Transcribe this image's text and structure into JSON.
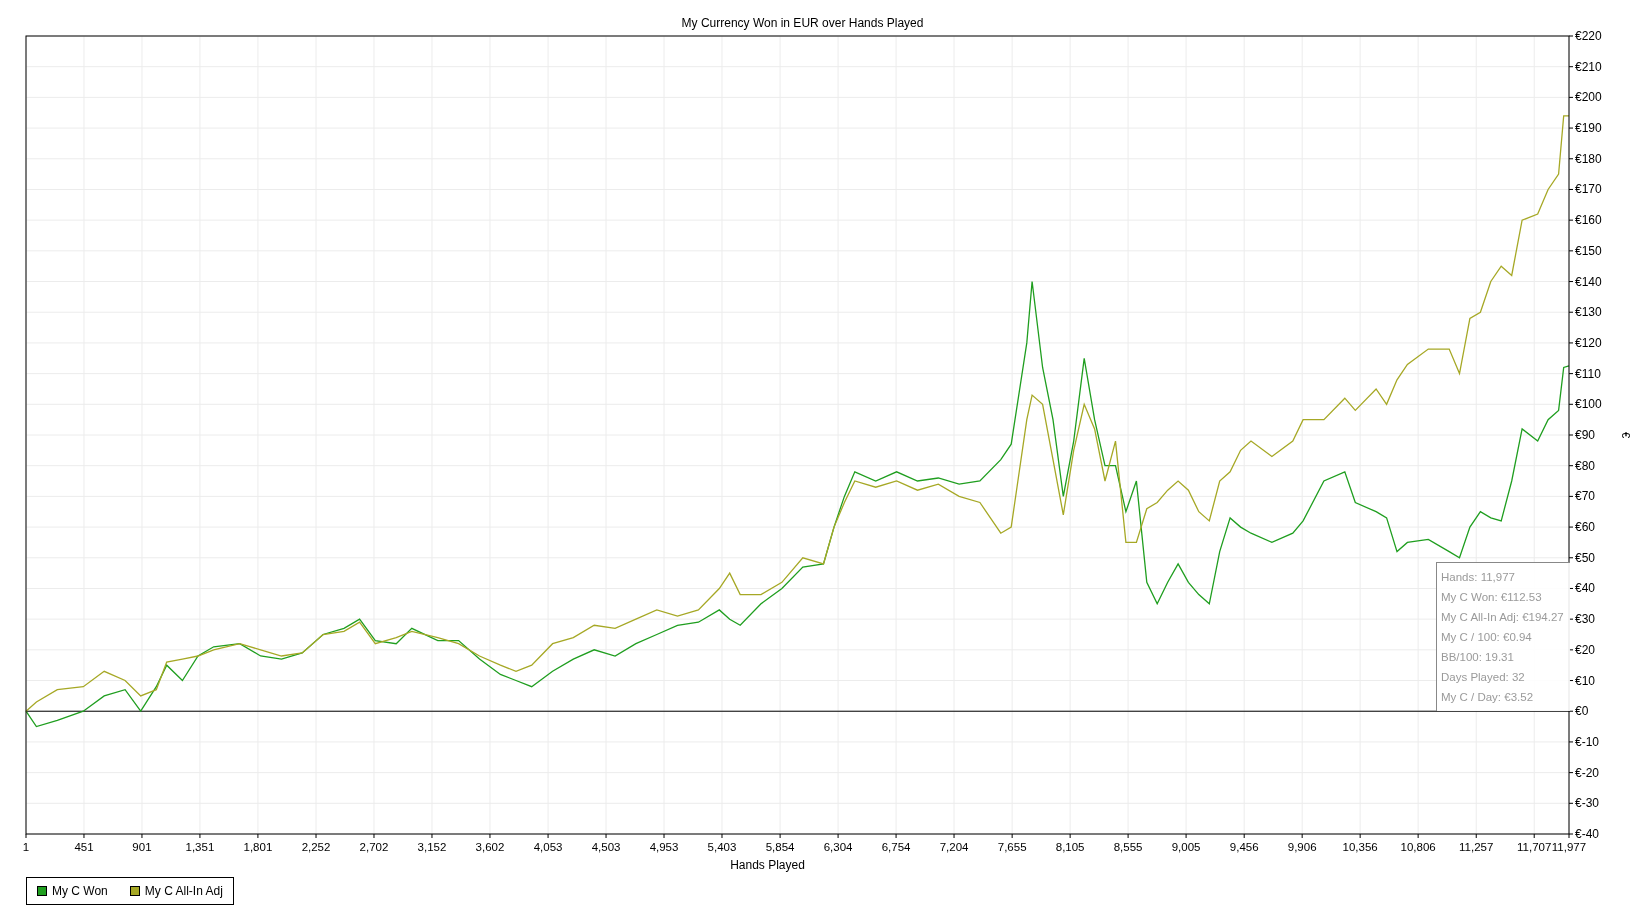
{
  "chart_data": {
    "type": "line",
    "title": "My Currency Won in EUR over Hands Played",
    "xlabel": "Hands Played",
    "ylabel": "€",
    "x": [
      1,
      82,
      244,
      446,
      608,
      770,
      891,
      1012,
      1093,
      1215,
      1336,
      1458,
      1660,
      1822,
      1984,
      2145,
      2307,
      2469,
      2590,
      2712,
      2874,
      2995,
      3197,
      3359,
      3521,
      3683,
      3804,
      3926,
      4088,
      4249,
      4411,
      4573,
      4735,
      4897,
      5058,
      5220,
      5382,
      5463,
      5544,
      5706,
      5868,
      6030,
      6191,
      6272,
      6353,
      6434,
      6596,
      6758,
      6920,
      7082,
      7243,
      7405,
      7567,
      7648,
      7769,
      7810,
      7891,
      7972,
      8052,
      8133,
      8214,
      8295,
      8376,
      8457,
      8538,
      8619,
      8700,
      8781,
      8862,
      8943,
      9023,
      9104,
      9185,
      9266,
      9347,
      9428,
      9509,
      9671,
      9833,
      9913,
      10075,
      10237,
      10318,
      10480,
      10561,
      10642,
      10723,
      10885,
      11047,
      11127,
      11208,
      11289,
      11370,
      11451,
      11532,
      11613,
      11734,
      11815,
      11896,
      11936,
      11977
    ],
    "series": [
      {
        "name": "My C Won",
        "color": "#1f9e1f",
        "values": [
          0,
          -5,
          -3,
          0,
          5,
          7,
          0,
          8,
          15,
          10,
          18,
          21,
          22,
          18,
          17,
          19,
          25,
          27,
          30,
          23,
          22,
          27,
          23,
          23,
          17,
          12,
          10,
          8,
          13,
          17,
          20,
          18,
          22,
          25,
          28,
          29,
          33,
          30,
          28,
          35,
          40,
          47,
          48,
          60,
          70,
          78,
          75,
          78,
          75,
          76,
          74,
          75,
          82,
          87,
          120,
          140,
          112,
          95,
          70,
          88,
          115,
          95,
          80,
          80,
          65,
          75,
          42,
          35,
          42,
          48,
          42,
          38,
          35,
          52,
          63,
          60,
          58,
          55,
          58,
          62,
          75,
          78,
          68,
          65,
          63,
          52,
          55,
          56,
          52,
          50,
          60,
          65,
          63,
          62,
          75,
          92,
          88,
          95,
          98,
          112,
          112.5
        ]
      },
      {
        "name": "My C All-In Adj",
        "color": "#a6a825",
        "values": [
          0,
          3,
          7,
          8,
          13,
          10,
          5,
          7,
          16,
          17,
          18,
          20,
          22,
          20,
          18,
          19,
          25,
          26,
          29,
          22,
          24,
          26,
          24,
          22,
          18,
          15,
          13,
          15,
          22,
          24,
          28,
          27,
          30,
          33,
          31,
          33,
          40,
          45,
          38,
          38,
          42,
          50,
          48,
          60,
          68,
          75,
          73,
          75,
          72,
          74,
          70,
          68,
          58,
          60,
          95,
          103,
          100,
          82,
          64,
          85,
          100,
          92,
          75,
          88,
          55,
          55,
          66,
          68,
          72,
          75,
          72,
          65,
          62,
          75,
          78,
          85,
          88,
          83,
          88,
          95,
          95,
          102,
          98,
          105,
          100,
          108,
          113,
          118,
          118,
          110,
          128,
          130,
          140,
          145,
          142,
          160,
          162,
          170,
          175,
          194,
          194
        ]
      }
    ],
    "xlim": [
      1,
      11977
    ],
    "ylim": [
      -40,
      220
    ],
    "xticks": [
      1,
      451,
      901,
      {
        "value": 1351,
        "label": "1,351"
      },
      {
        "value": 1801,
        "label": "1,801"
      },
      {
        "value": 2252,
        "label": "2,252"
      },
      {
        "value": 2702,
        "label": "2,702"
      },
      {
        "value": 3152,
        "label": "3,152"
      },
      {
        "value": 3602,
        "label": "3,602"
      },
      {
        "value": 4053,
        "label": "4,053"
      },
      {
        "value": 4503,
        "label": "4,503"
      },
      {
        "value": 4953,
        "label": "4,953"
      },
      {
        "value": 5403,
        "label": "5,403"
      },
      {
        "value": 5854,
        "label": "5,854"
      },
      {
        "value": 6304,
        "label": "6,304"
      },
      {
        "value": 6754,
        "label": "6,754"
      },
      {
        "value": 7204,
        "label": "7,204"
      },
      {
        "value": 7655,
        "label": "7,655"
      },
      {
        "value": 8105,
        "label": "8,105"
      },
      {
        "value": 8555,
        "label": "8,555"
      },
      {
        "value": 9005,
        "label": "9,005"
      },
      {
        "value": 9456,
        "label": "9,456"
      },
      {
        "value": 9906,
        "label": "9,906"
      },
      {
        "value": 10356,
        "label": "10,356"
      },
      {
        "value": 10806,
        "label": "10,806"
      },
      {
        "value": 11257,
        "label": "11,257"
      },
      {
        "value": 11707,
        "label": "11,707"
      },
      {
        "value": 11977,
        "label": "11,977"
      }
    ],
    "grid": true,
    "yticks": [
      {
        "value": 220,
        "label": "€220"
      },
      {
        "value": 210,
        "label": "€210"
      },
      {
        "value": 200,
        "label": "€200"
      },
      {
        "value": 190,
        "label": "€190"
      },
      {
        "value": 180,
        "label": "€180"
      },
      {
        "value": 170,
        "label": "€170"
      },
      {
        "value": 160,
        "label": "€160"
      },
      {
        "value": 150,
        "label": "€150"
      },
      {
        "value": 140,
        "label": "€140"
      },
      {
        "value": 130,
        "label": "€130"
      },
      {
        "value": 120,
        "label": "€120"
      },
      {
        "value": 110,
        "label": "€110"
      },
      {
        "value": 100,
        "label": "€100"
      },
      {
        "value": 90,
        "label": "€90"
      },
      {
        "value": 80,
        "label": "€80"
      },
      {
        "value": 70,
        "label": "€70"
      },
      {
        "value": 60,
        "label": "€60"
      },
      {
        "value": 50,
        "label": "€50"
      },
      {
        "value": 40,
        "label": "€40"
      },
      {
        "value": 30,
        "label": "€30"
      },
      {
        "value": 20,
        "label": "€20"
      },
      {
        "value": 10,
        "label": "€10"
      },
      {
        "value": 0,
        "label": "€0"
      },
      {
        "value": -10,
        "label": "€-10"
      },
      {
        "value": -20,
        "label": "€-20"
      },
      {
        "value": -30,
        "label": "€-30"
      },
      {
        "value": -40,
        "label": "€-40"
      }
    ]
  },
  "tooltip": {
    "lines": [
      "Hands: 11,977",
      "My C Won: €112.53",
      "My C All-In Adj: €194.27",
      "My C / 100: €0.94",
      "BB/100: 19.31",
      "Days Played: 32",
      "My C / Day: €3.52"
    ]
  }
}
